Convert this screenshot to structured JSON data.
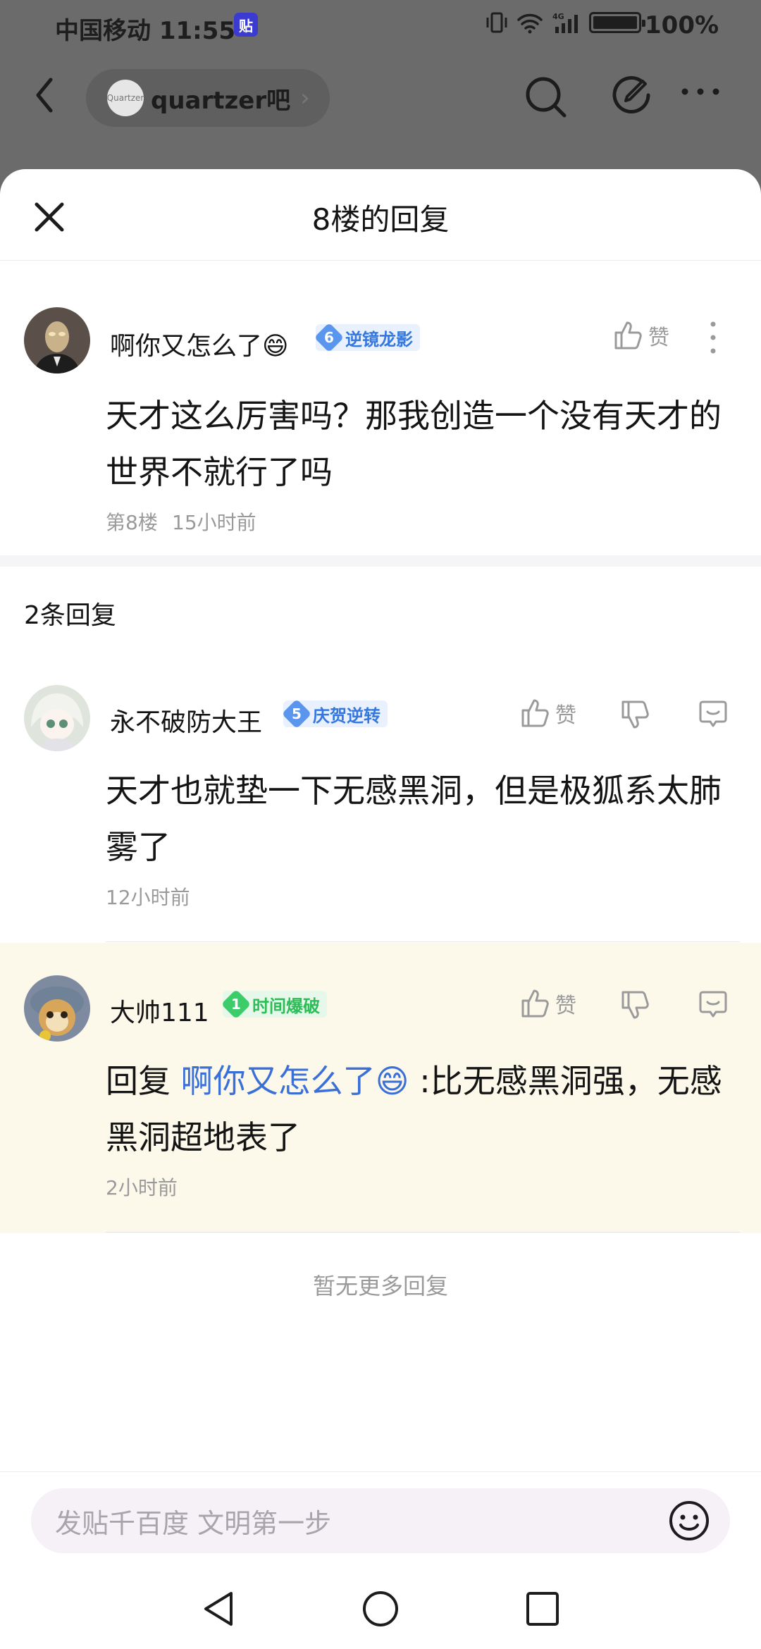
{
  "status_bar": {
    "carrier_time": "中国移动 11:55",
    "app_badge": "贴",
    "network": "4G",
    "battery_pct": "100%",
    "battery_level": 1.0
  },
  "topbar": {
    "forum_logo_text": "Quartzer",
    "forum_name": "quartzer吧",
    "icons": [
      "back-icon",
      "search-icon",
      "edit-icon",
      "more-icon"
    ]
  },
  "sheet": {
    "title": "8楼的回复",
    "close_icon": "close-icon"
  },
  "main_post": {
    "username": "啊你又怎么了😄",
    "level": "6",
    "badge": "逆镜龙影",
    "like_label": "赞",
    "content": "天才这么厉害吗？那我创造一个没有天才的世界不就行了吗",
    "floor": "第8楼",
    "time": "15小时前"
  },
  "replies_count": "2条回复",
  "replies": [
    {
      "username": "永不破防大王",
      "level": "5",
      "badge": "庆贺逆转",
      "like_label": "赞",
      "content": "天才也就垫一下无感黑洞，但是极狐系太肺雾了",
      "time": "12小时前"
    },
    {
      "username": "大帅111",
      "level": "1",
      "badge": "时间爆破",
      "like_label": "赞",
      "reply_prefix": "回复 ",
      "reply_to": "啊你又怎么了😄",
      "content": " :比无感黑洞强，无感黑洞超地表了",
      "time": "2小时前"
    }
  ],
  "no_more": "暂无更多回复",
  "input": {
    "placeholder": "发贴千百度 文明第一步"
  },
  "colors": {
    "accent_blue": "#3a6fd8",
    "badge_blue": "#3477e0",
    "badge_green": "#2cbd57",
    "highlight_bg": "#fcf8ea"
  }
}
